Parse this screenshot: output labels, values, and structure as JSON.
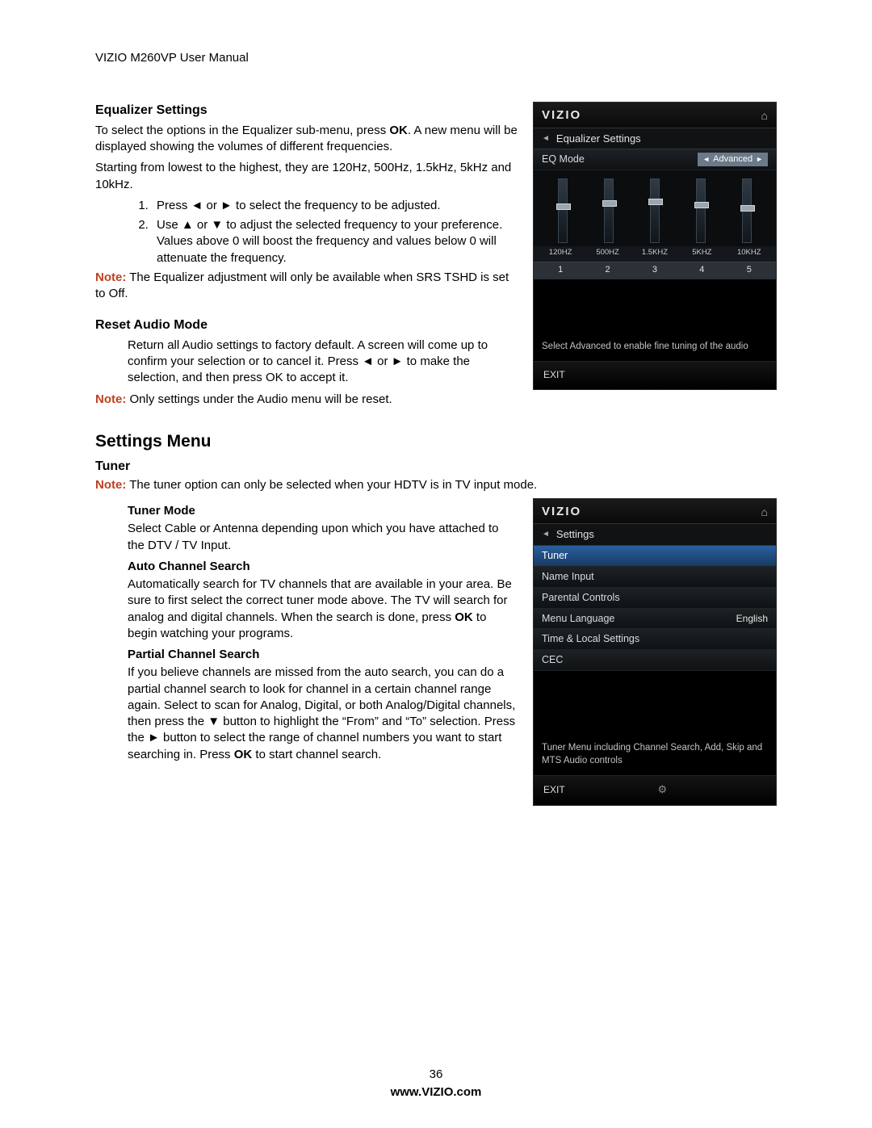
{
  "doc": {
    "header": "VIZIO M260VP User Manual",
    "page_number": "36",
    "footer_url": "www.VIZIO.com"
  },
  "eq": {
    "heading": "Equalizer Settings",
    "p1a": "To select the options in the Equalizer sub-menu, press ",
    "p1b": "OK",
    "p1c": ". A new menu will be displayed showing the volumes of different frequencies.",
    "p2": "Starting from lowest to the highest, they are 120Hz, 500Hz, 1.5kHz, 5kHz and 10kHz.",
    "step1": "Press ◄ or ► to select the frequency to be adjusted.",
    "step2": "Use ▲ or ▼ to adjust the selected frequency to your preference. Values above 0 will boost the frequency and values below 0 will attenuate the frequency.",
    "note_label": "Note:",
    "note": " The Equalizer adjustment will only be available when SRS TSHD is set to Off."
  },
  "reset": {
    "heading": "Reset Audio Mode",
    "body": "Return all Audio settings to factory default. A screen will come up to confirm your selection or to cancel it. Press ◄ or ► to make the selection, and then press OK to accept it.",
    "note_label": "Note:",
    "note": " Only settings under the Audio menu will be reset."
  },
  "settings": {
    "heading": "Settings Menu",
    "tuner_heading": "Tuner",
    "tuner_note_label": "Note:",
    "tuner_note": " The tuner option can only be selected when your HDTV is in TV input mode.",
    "mode_heading": "Tuner Mode",
    "mode_body": "Select Cable or Antenna depending upon which you have attached to the DTV / TV Input.",
    "auto_heading": "Auto Channel Search",
    "auto_a": "Automatically search for TV channels that are available in your area. Be sure to first select the correct tuner mode above. The TV will search for analog and digital channels. When the search is done, press ",
    "auto_b": "OK",
    "auto_c": " to begin watching your programs.",
    "partial_heading": "Partial Channel Search",
    "partial_a": "If you believe channels are missed from the auto search, you can do a partial channel search to look for channel in a certain channel range again. Select to scan for Analog, Digital, or both Analog/Digital channels, then press the ▼ button to highlight the “From” and “To” selection. Press the ► button to select the range of channel numbers you want to start searching in. Press ",
    "partial_b": "OK",
    "partial_c": " to start channel search."
  },
  "osd1": {
    "logo": "VIZIO",
    "title": "Equalizer Settings",
    "eq_mode_label": "EQ Mode",
    "eq_mode_value": "Advanced",
    "freqs": [
      "120HZ",
      "500HZ",
      "1.5KHZ",
      "5KHZ",
      "10KHZ"
    ],
    "nums": [
      "1",
      "2",
      "3",
      "4",
      "5"
    ],
    "hint": "Select Advanced to enable fine tuning of the audio",
    "exit": "EXIT"
  },
  "osd2": {
    "logo": "VIZIO",
    "title": "Settings",
    "items": [
      {
        "label": "Tuner",
        "value": "",
        "selected": true
      },
      {
        "label": "Name Input",
        "value": ""
      },
      {
        "label": "Parental Controls",
        "value": ""
      },
      {
        "label": "Menu Language",
        "value": "English"
      },
      {
        "label": "Time & Local Settings",
        "value": ""
      },
      {
        "label": "CEC",
        "value": ""
      }
    ],
    "hint": "Tuner Menu including Channel Search, Add, Skip and MTS Audio controls",
    "exit": "EXIT"
  }
}
